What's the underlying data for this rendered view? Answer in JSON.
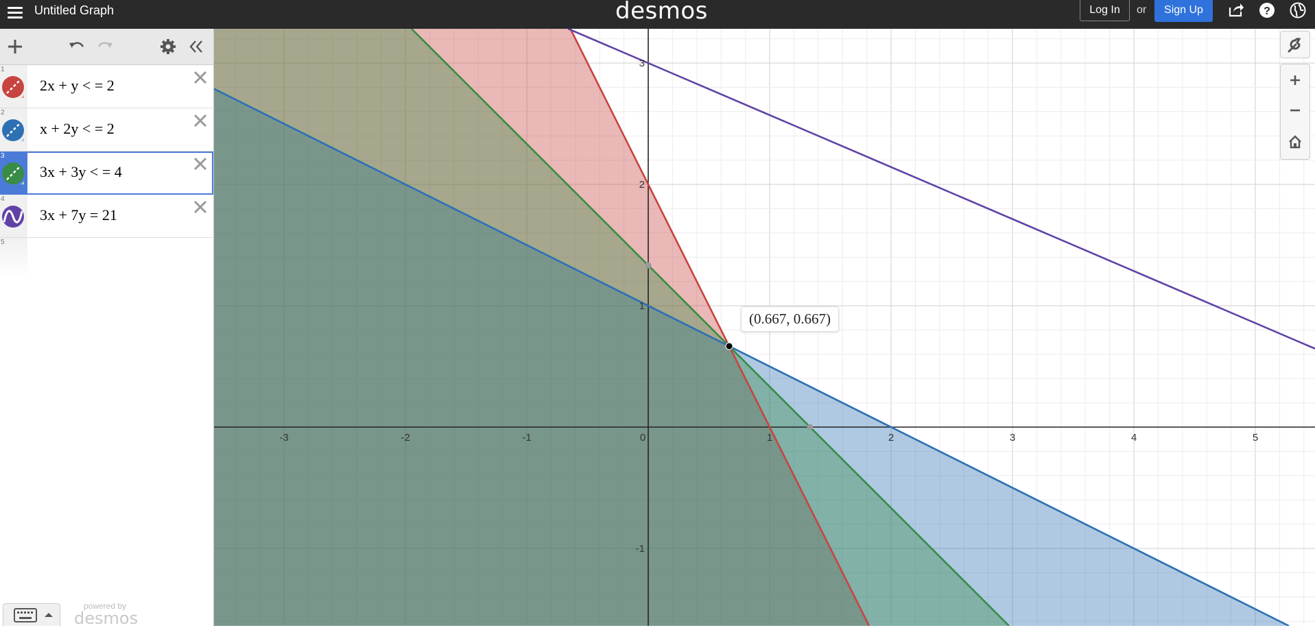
{
  "header": {
    "graph_title": "Untitled Graph",
    "brand": "desmos",
    "login_label": "Log In",
    "or_text": "or",
    "signup_label": "Sign Up",
    "background": "#2a2a2a",
    "signup_color": "#2f72dc"
  },
  "toolbar": {
    "icons": [
      "add-icon",
      "undo-icon",
      "redo-icon",
      "gear-icon",
      "collapse-icon"
    ]
  },
  "expressions": [
    {
      "index": "1",
      "latex": "2x + y < = 2",
      "color": "#c74440",
      "type": "inequality",
      "selected": false
    },
    {
      "index": "2",
      "latex": "x + 2y < = 2",
      "color": "#2d70b3",
      "type": "inequality",
      "selected": false
    },
    {
      "index": "3",
      "latex": "3x + 3y < = 4",
      "color": "#388c46",
      "type": "inequality",
      "selected": true
    },
    {
      "index": "4",
      "latex": "3x + 7y = 21",
      "color": "#6042a6",
      "type": "line",
      "selected": false
    },
    {
      "index": "5",
      "latex": "",
      "color": "",
      "type": "empty",
      "selected": false
    }
  ],
  "footer": {
    "powered_by": "powered by",
    "brand": "desmos",
    "keyboard_icon": "keyboard-icon"
  },
  "graph": {
    "x_ticks": [
      "-3",
      "-2",
      "-1",
      "0",
      "1",
      "2",
      "3",
      "4",
      "5"
    ],
    "y_ticks": [
      "3",
      "2",
      "1",
      "-1"
    ],
    "intersection_label": "(0.667, 0.667)",
    "intersection": [
      0.667,
      0.667
    ],
    "grid_visible": true
  },
  "chart_data": {
    "type": "scatter",
    "title": "",
    "xlabel": "",
    "ylabel": "",
    "xlim": [
      -3.58,
      5.5
    ],
    "ylim": [
      -1.65,
      3.3
    ],
    "series": [
      {
        "name": "2x + y < = 2",
        "kind": "region-below",
        "a": 2,
        "b": 1,
        "c": 2,
        "color": "#c74440"
      },
      {
        "name": "x + 2y < = 2",
        "kind": "region-below",
        "a": 1,
        "b": 2,
        "c": 2,
        "color": "#2d70b3"
      },
      {
        "name": "3x + 3y < = 4",
        "kind": "region-below",
        "a": 3,
        "b": 3,
        "c": 4,
        "color": "#388c46"
      },
      {
        "name": "3x + 7y = 21",
        "kind": "line",
        "a": 3,
        "b": 7,
        "c": 21,
        "color": "#6042a6"
      }
    ],
    "points": [
      {
        "x": 0.667,
        "y": 0.667,
        "label": "(0.667, 0.667)",
        "color": "#000000"
      },
      {
        "x": 0,
        "y": 1.333,
        "label": "",
        "color": "#999999"
      },
      {
        "x": 1.333,
        "y": 0,
        "label": "",
        "color": "#999999"
      }
    ]
  }
}
